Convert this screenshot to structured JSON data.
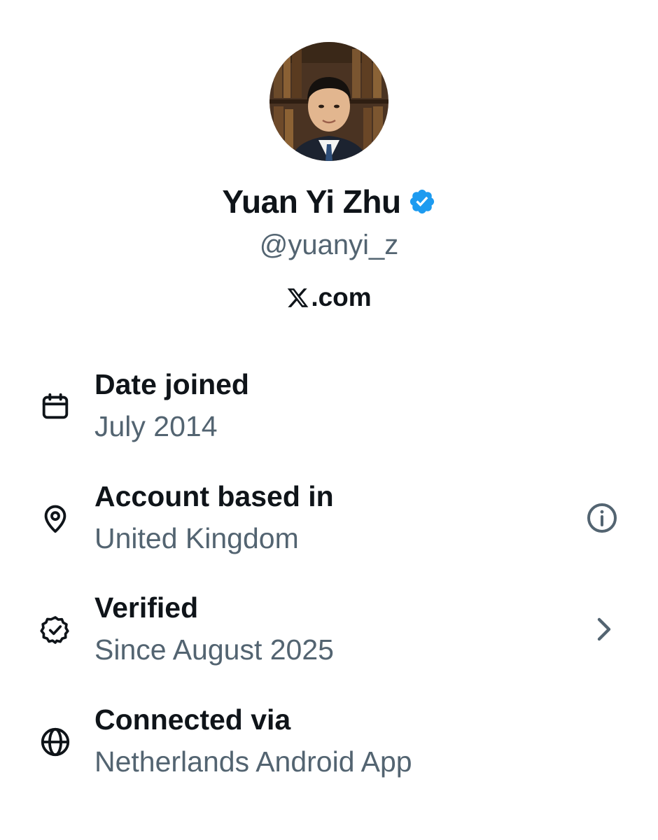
{
  "profile": {
    "display_name": "Yuan Yi Zhu",
    "handle": "@yuanyi_z",
    "verified": true,
    "verified_badge_color": "#1d9bf0",
    "source_label": ".com",
    "source_logo": "x-logo"
  },
  "about": [
    {
      "label": "Date joined",
      "value": "July 2014",
      "icon": "calendar-icon"
    },
    {
      "label": "Account based in",
      "value": "United Kingdom",
      "icon": "location-pin-icon",
      "action_icon": "info-icon"
    },
    {
      "label": "Verified",
      "value": "Since August 2025",
      "icon": "verified-badge-outline-icon",
      "action_icon": "chevron-right-icon"
    },
    {
      "label": "Connected via",
      "value": "Netherlands Android App",
      "icon": "globe-icon"
    }
  ],
  "colors": {
    "primary_text": "#0f1419",
    "secondary_text": "#536471",
    "accent": "#1d9bf0"
  }
}
